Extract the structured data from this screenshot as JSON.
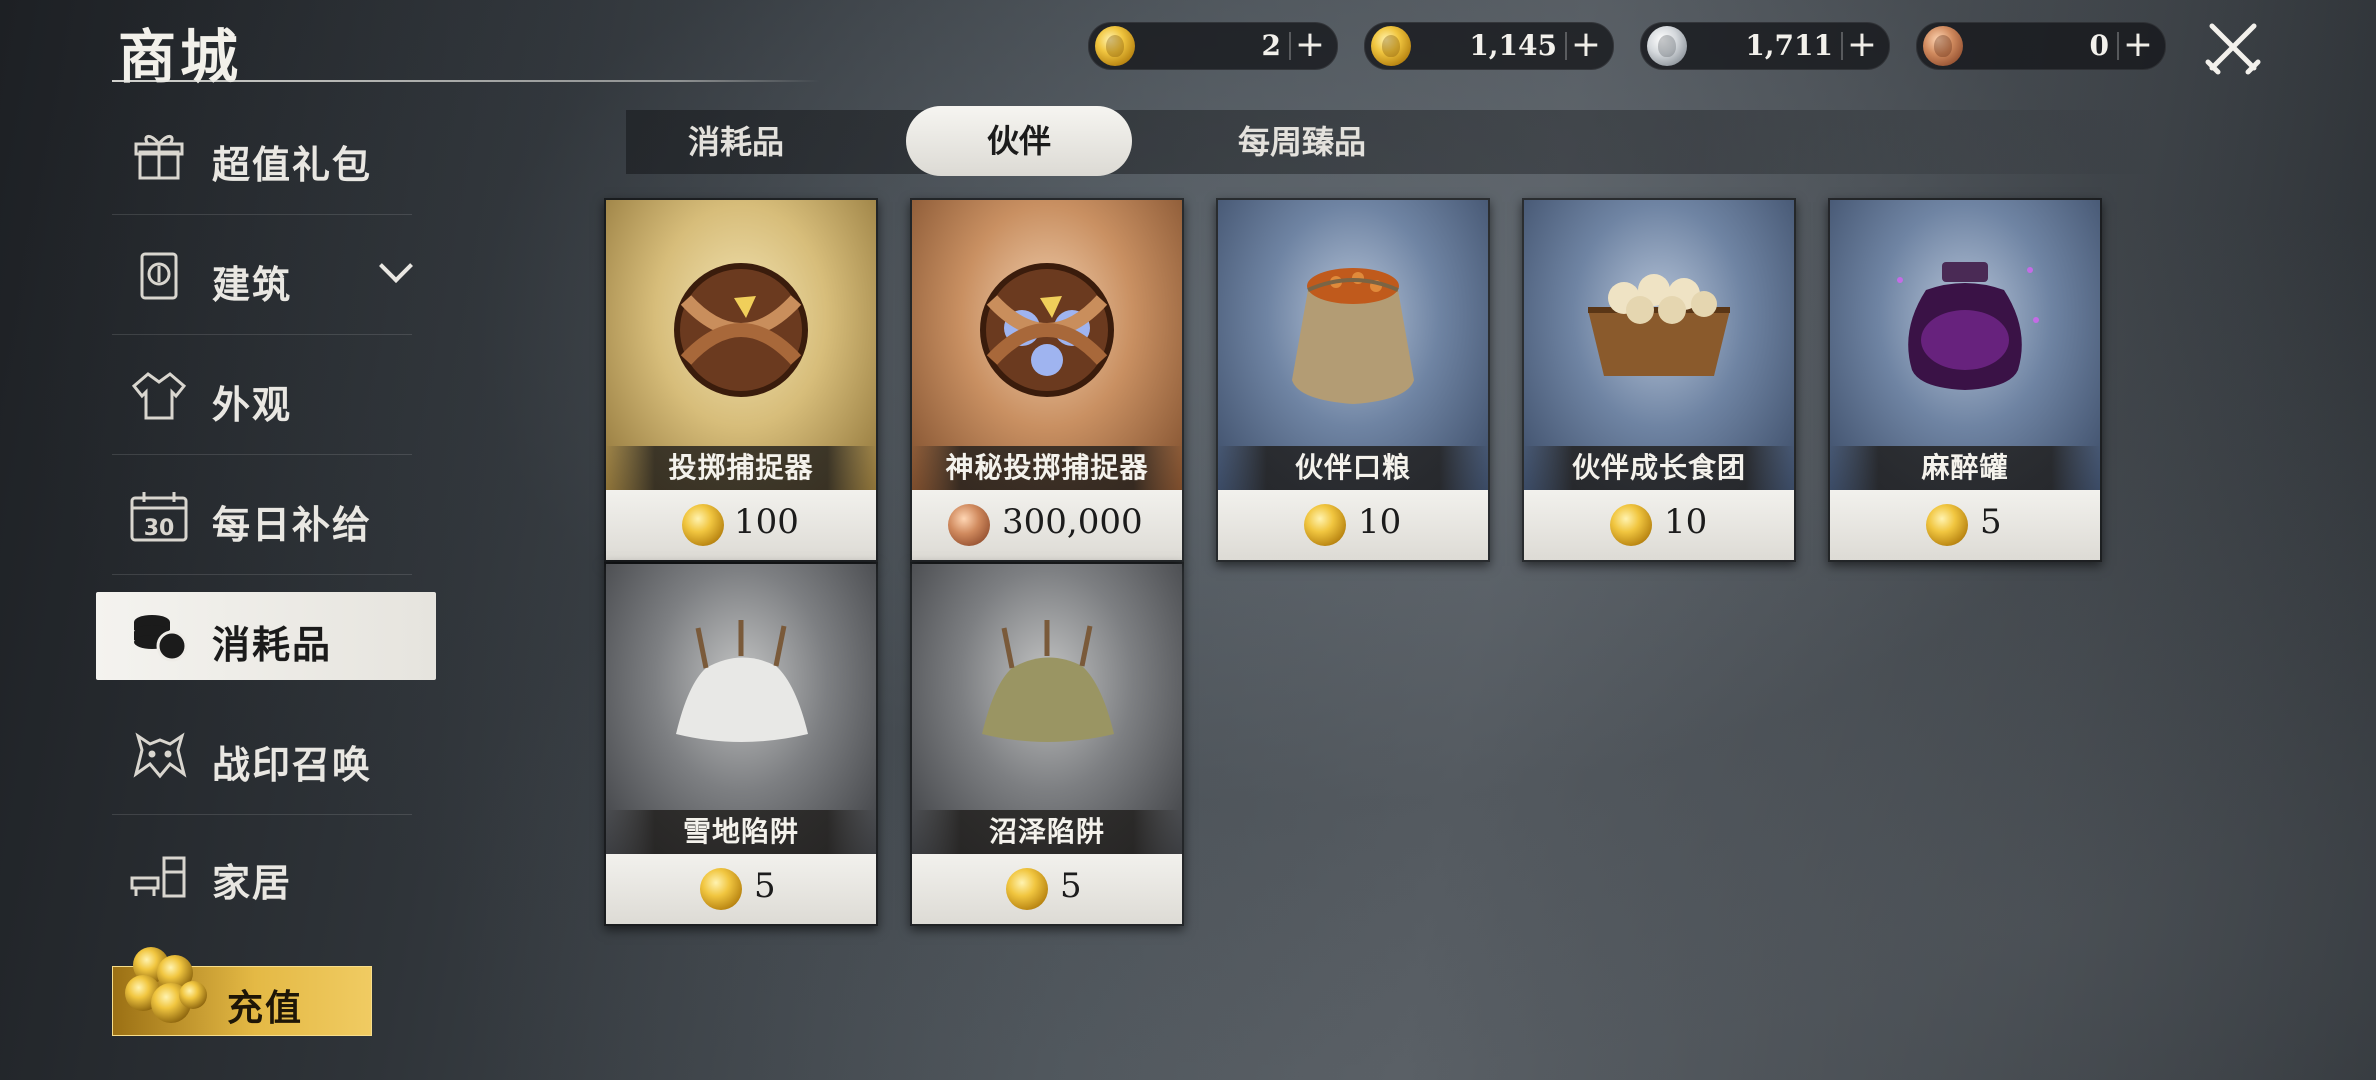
{
  "header": {
    "title": "商城"
  },
  "currencies": [
    {
      "icon": "gold-coin-icon",
      "value": "2"
    },
    {
      "icon": "gold-coin-icon",
      "value": "1,145"
    },
    {
      "icon": "silver-coin-icon",
      "value": "1,711"
    },
    {
      "icon": "bronze-coin-icon",
      "value": "0"
    }
  ],
  "currency_plus": "+",
  "sidebar": {
    "items": [
      {
        "label": "超值礼包",
        "icon": "gift-box-icon"
      },
      {
        "label": "建筑",
        "icon": "building-icon",
        "expandable": true
      },
      {
        "label": "外观",
        "icon": "outfit-icon"
      },
      {
        "label": "每日补给",
        "icon": "calendar-icon",
        "icon_text": "30"
      },
      {
        "label": "消耗品",
        "icon": "coin-stack-icon",
        "selected": true
      },
      {
        "label": "战印召唤",
        "icon": "wolf-icon"
      },
      {
        "label": "家居",
        "icon": "furniture-icon"
      }
    ],
    "recharge_label": "充值"
  },
  "tabs": [
    {
      "label": "消耗品"
    },
    {
      "label": "伙伴",
      "selected": true
    },
    {
      "label": "每周臻品"
    }
  ],
  "items": [
    {
      "name": "投掷捕捉器",
      "price": "100",
      "currency": "gold"
    },
    {
      "name": "神秘投掷捕捉器",
      "price": "300,000",
      "currency": "bronze"
    },
    {
      "name": "伙伴口粮",
      "price": "10",
      "currency": "gold"
    },
    {
      "name": "伙伴成长食团",
      "price": "10",
      "currency": "gold"
    },
    {
      "name": "麻醉罐",
      "price": "5",
      "currency": "gold"
    },
    {
      "name": "雪地陷阱",
      "price": "5",
      "currency": "gold"
    },
    {
      "name": "沼泽陷阱",
      "price": "5",
      "currency": "gold"
    }
  ],
  "colors": {
    "accent_gold": "#e4b945",
    "panel_dark": "#1d2024",
    "text_light": "#e9e6df"
  }
}
